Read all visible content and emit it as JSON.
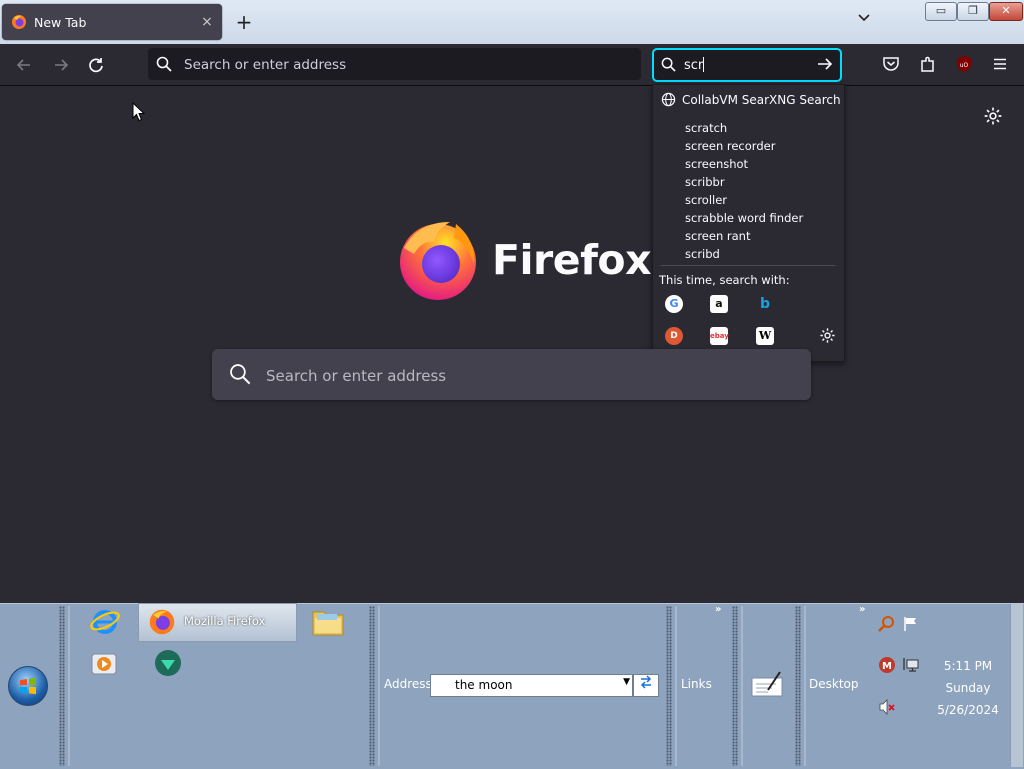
{
  "window": {
    "tab_title": "New Tab",
    "tab_close": "×",
    "new_tab": "+",
    "tab_list": "⌄",
    "controls": {
      "minimize": "▭",
      "maximize": "❐",
      "close": "✕"
    }
  },
  "nav": {
    "url_placeholder": "Search or enter address",
    "search_value": "scr"
  },
  "search_dropdown": {
    "engine_header": "CollabVM SearXNG Search",
    "suggestions": [
      "scratch",
      "screen recorder",
      "screenshot",
      "scribbr",
      "scroller",
      "scrabble word finder",
      "screen rant",
      "scribd"
    ],
    "this_time_label": "This time, search with:",
    "engines": [
      "google-icon",
      "amazon-icon",
      "bing-icon",
      "duckduckgo-icon",
      "ebay-icon",
      "wikipedia-icon"
    ]
  },
  "page": {
    "brand": "Firefox",
    "search_placeholder": "Search or enter address"
  },
  "taskbar": {
    "active_task": "Mozilla Firefox",
    "address_label": "Address",
    "address_value": "the moon",
    "links_label": "Links",
    "desktop_label": "Desktop",
    "chevron": "»",
    "clock_time": "5:11 PM",
    "clock_day": "Sunday",
    "clock_date": "5/26/2024"
  },
  "colors": {
    "accent": "#00ddff",
    "toolbar_bg": "#2b2a33",
    "taskbar_bg": "#8ea3bd"
  }
}
